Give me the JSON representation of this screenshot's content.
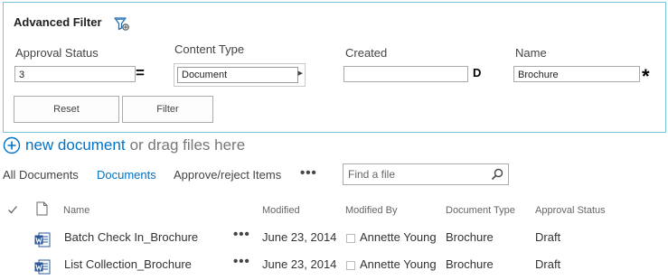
{
  "filter": {
    "title": "Advanced Filter",
    "approval_status_label": "Approval Status",
    "approval_status_value": "3",
    "approval_status_operator": "=",
    "content_type_label": "Content Type",
    "content_type_value": "Document",
    "created_label": "Created",
    "created_value": "",
    "created_operator": "D",
    "name_label": "Name",
    "name_value": "Brochure",
    "name_operator": "*",
    "reset_label": "Reset",
    "filter_label": "Filter"
  },
  "new_document": {
    "link": "new document",
    "rest": "or drag files here"
  },
  "views": {
    "all_documents": "All Documents",
    "documents": "Documents",
    "approve_reject": "Approve/reject Items",
    "more": "•••",
    "search_placeholder": "Find a file"
  },
  "columns": {
    "name": "Name",
    "modified": "Modified",
    "modified_by": "Modified By",
    "document_type": "Document Type",
    "approval_status": "Approval Status"
  },
  "rows": [
    {
      "name": "Batch Check In_Brochure",
      "menu": "•••",
      "modified": "June 23, 2014",
      "modified_by": "Annette Young",
      "document_type": "Brochure",
      "approval_status": "Draft"
    },
    {
      "name": "List Collection_Brochure",
      "menu": "•••",
      "modified": "June 23, 2014",
      "modified_by": "Annette Young",
      "document_type": "Brochure",
      "approval_status": "Draft"
    }
  ],
  "colors": {
    "accent": "#0072c6",
    "panel_border": "#7ac4e2",
    "word_blue": "#2b579a"
  }
}
